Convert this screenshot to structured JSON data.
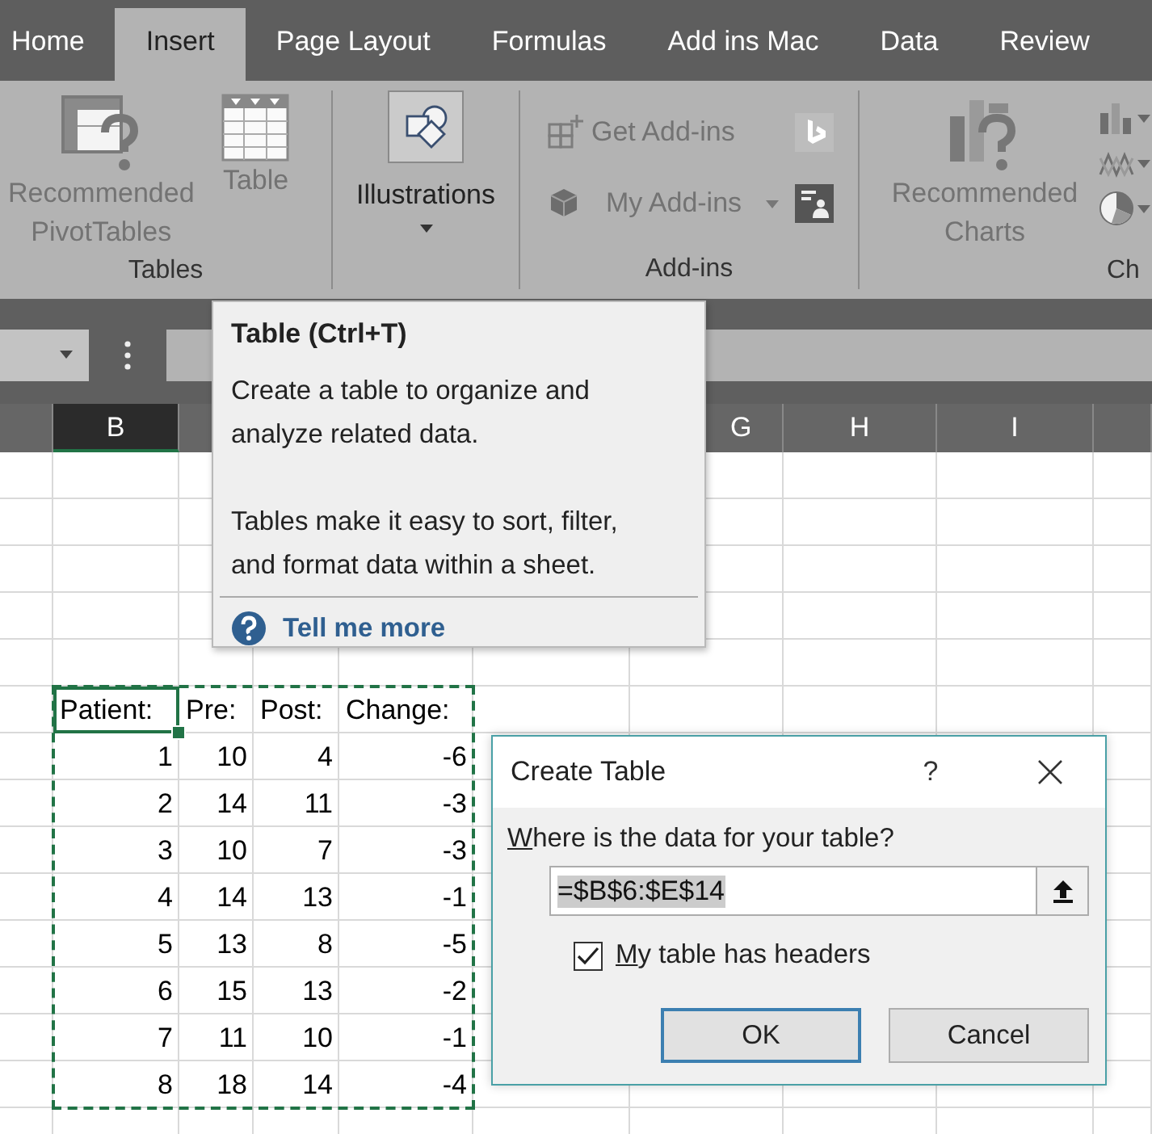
{
  "tabs": [
    {
      "label": "Home",
      "selected": false
    },
    {
      "label": "Insert",
      "selected": true
    },
    {
      "label": "Page Layout",
      "selected": false
    },
    {
      "label": "Formulas",
      "selected": false
    },
    {
      "label": "Add ins Mac",
      "selected": false
    },
    {
      "label": "Data",
      "selected": false
    },
    {
      "label": "Review",
      "selected": false
    }
  ],
  "ribbon": {
    "tables": {
      "label": "Tables",
      "buttons": [
        {
          "label": "Recommended\nPivotTables",
          "disabled": true
        },
        {
          "label": "Table",
          "disabled": true
        }
      ]
    },
    "illustrations": {
      "label": "Illustrations",
      "disabled": false,
      "highlighted": true
    },
    "add_ins": {
      "label": "Add-ins",
      "get_add_ins": {
        "label": "Get Add-ins",
        "disabled": true
      },
      "my_add_ins": {
        "label": "My Add-ins",
        "disabled": true
      }
    },
    "charts": {
      "label": "Ch",
      "recommended_charts": {
        "label": "Recommended\nCharts",
        "disabled": true
      }
    }
  },
  "column_headers": [
    {
      "label": "B",
      "selected": true
    },
    {
      "label": "G",
      "selected": false
    },
    {
      "label": "H",
      "selected": false
    },
    {
      "label": "I",
      "selected": false
    }
  ],
  "table": {
    "columns": [
      {
        "label": "Patient:",
        "active": true
      },
      {
        "label": "Pre:",
        "active": false
      },
      {
        "label": "Post:",
        "active": false
      },
      {
        "label": "Change:",
        "active": false
      }
    ],
    "rows": [
      [
        "1",
        "10",
        "4",
        "-6"
      ],
      [
        "2",
        "14",
        "11",
        "-3"
      ],
      [
        "3",
        "10",
        "7",
        "-3"
      ],
      [
        "4",
        "14",
        "13",
        "-1"
      ],
      [
        "5",
        "13",
        "8",
        "-5"
      ],
      [
        "6",
        "15",
        "13",
        "-2"
      ],
      [
        "7",
        "11",
        "10",
        "-1"
      ],
      [
        "8",
        "18",
        "14",
        "-4"
      ]
    ],
    "marquee": true
  },
  "tooltip": {
    "title": "Table (Ctrl+T)",
    "paragraphs": [
      "Create a table to organize and analyze related data.",
      "Tables make it easy to sort, filter, and format data within a sheet."
    ],
    "link": "Tell me more"
  },
  "dialog": {
    "title": "Create Table",
    "help": "?",
    "range_label": {
      "access_key": "W",
      "text": "here is the data for your table?"
    },
    "range_field": {
      "value": "=$B$6:$E$14",
      "value_selected": true
    },
    "headers_checkbox": {
      "access_key": "M",
      "label": "y table has headers",
      "checked": true
    },
    "buttons": [
      {
        "label": "OK",
        "default": true
      },
      {
        "label": "Cancel",
        "default": false
      }
    ]
  }
}
